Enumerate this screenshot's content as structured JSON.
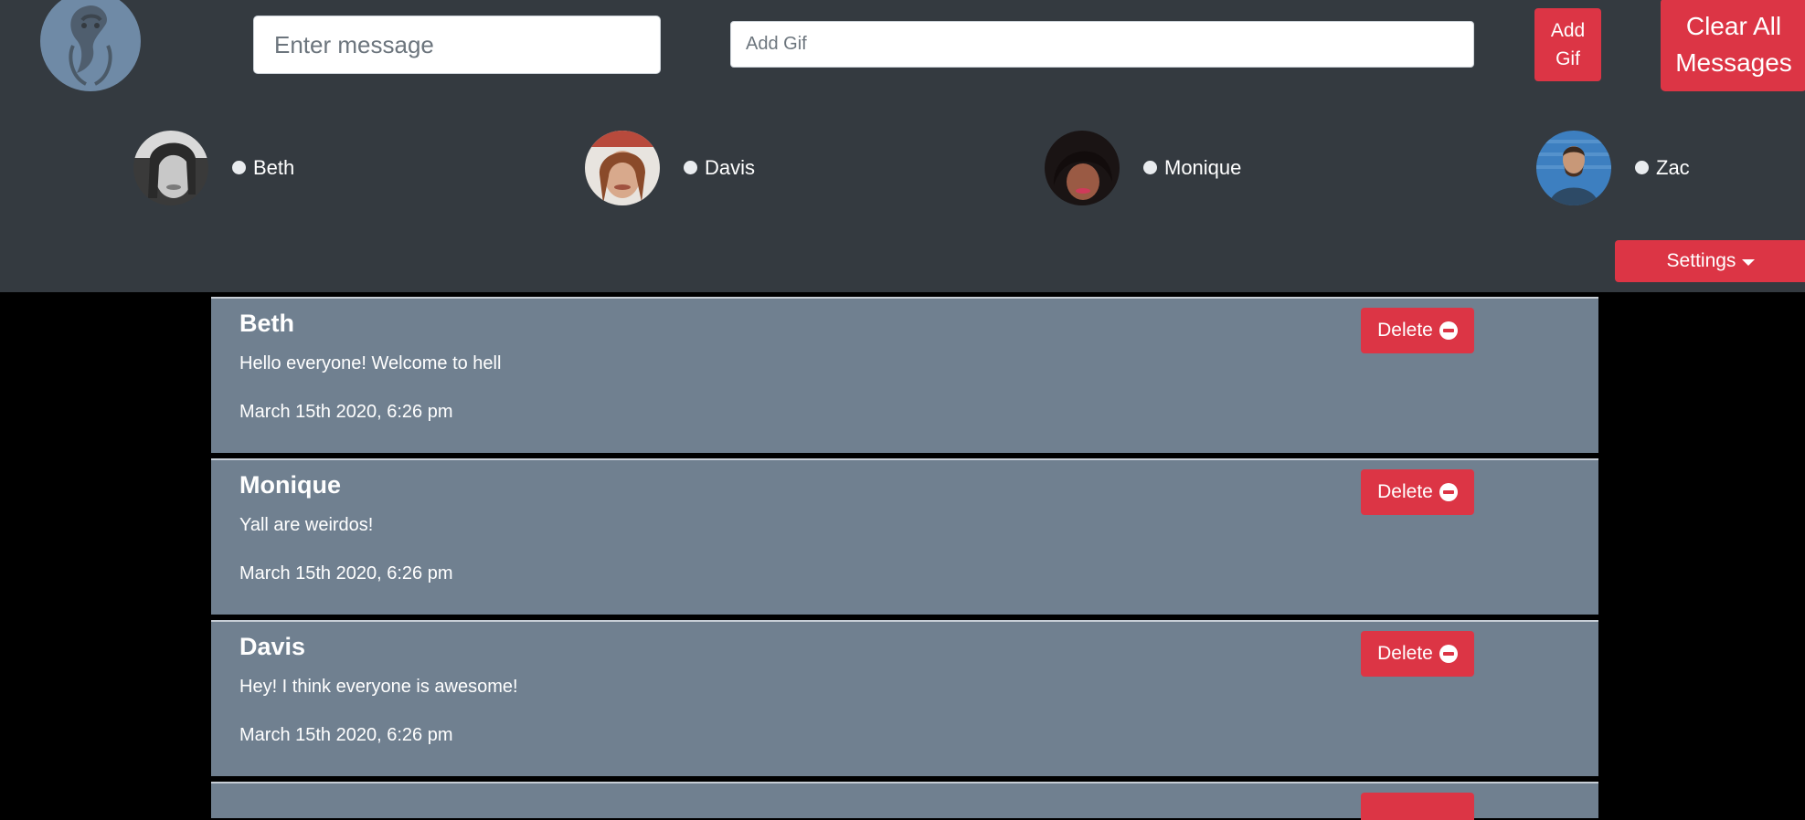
{
  "header": {
    "logo_icon": "snake-logo-icon",
    "message_placeholder": "Enter message",
    "gif_placeholder": "Add Gif",
    "add_gif_label": "Add Gif",
    "clear_all_label": "Clear All Messages",
    "settings_label": "Settings"
  },
  "users": [
    {
      "name": "Beth"
    },
    {
      "name": "Davis"
    },
    {
      "name": "Monique"
    },
    {
      "name": "Zac"
    }
  ],
  "messages": [
    {
      "author": "Beth",
      "text": "Hello everyone! Welcome to hell",
      "time": "March 15th 2020, 6:26 pm",
      "delete_label": "Delete"
    },
    {
      "author": "Monique",
      "text": "Yall are weirdos!",
      "time": "March 15th 2020, 6:26 pm",
      "delete_label": "Delete"
    },
    {
      "author": "Davis",
      "text": "Hey! I think everyone is awesome!",
      "time": "March 15th 2020, 6:26 pm",
      "delete_label": "Delete"
    }
  ],
  "colors": {
    "header_bg": "#343a40",
    "accent": "#dc3545",
    "card_bg": "#708090",
    "page_bg": "#000000"
  }
}
